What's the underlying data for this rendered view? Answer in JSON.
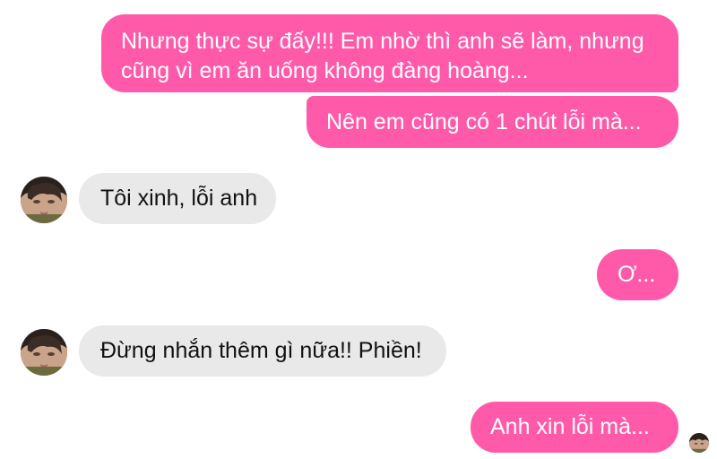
{
  "messages": [
    {
      "direction": "outgoing",
      "lines": [
        "Nhưng thực sự đấy!!! Em nhờ thì anh sẽ làm, nhưng",
        "cũng vì em ăn uống không đàng hoàng..."
      ]
    },
    {
      "direction": "outgoing",
      "text": "Nên em cũng có 1 chút lỗi mà..."
    },
    {
      "direction": "incoming",
      "text": "Tôi xinh, lỗi anh",
      "avatar_icon": "contact-avatar-icon"
    },
    {
      "direction": "outgoing",
      "text": "Ơ..."
    },
    {
      "direction": "incoming",
      "text": "Đừng nhắn thêm gì nữa!! Phiền!",
      "avatar_icon": "contact-avatar-icon"
    },
    {
      "direction": "outgoing",
      "text": "Anh xin lỗi mà...",
      "seen_icon": "seen-avatar-icon"
    }
  ],
  "colors": {
    "outgoing_bubble": "#ff5aaa",
    "outgoing_text": "#ffffff",
    "incoming_bubble": "#e9e9e9",
    "incoming_text": "#111111"
  }
}
